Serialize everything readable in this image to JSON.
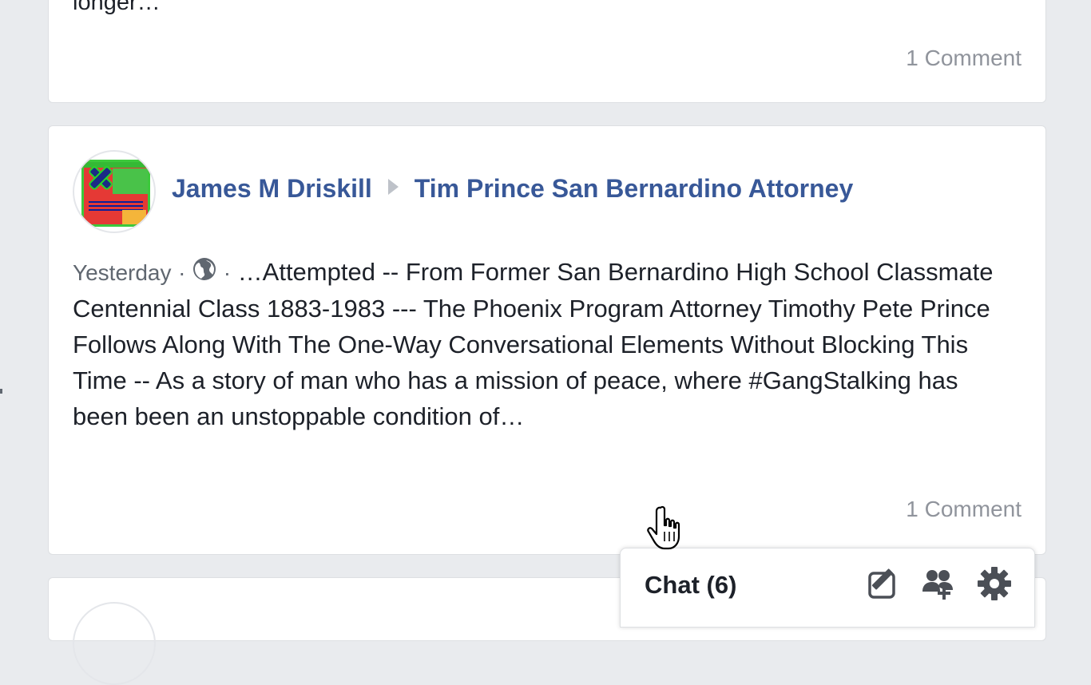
{
  "posts": [
    {
      "text_end": "longer…",
      "comments": "1 Comment"
    },
    {
      "author": "James M Driskill",
      "target": "Tim Prince San Bernardino Attorney",
      "timestamp": "Yesterday",
      "separator": "·",
      "privacy_icon": "globe-icon",
      "text": "…Attempted -- From Former San Bernardino High School Classmate Centennial Class 1883-1983 --- The Phoenix Program Attorney Timothy Pete Prince Follows Along With The One-Way Conversational Elements Without Blocking This Time -- As a story of man who has a mission of peace, where #GangStalking has been been an unstoppable condition of…",
      "comments": "1 Comment"
    }
  ],
  "chat": {
    "title": "Chat (6)",
    "icons": [
      "compose-icon",
      "create-group-icon",
      "gear-icon"
    ]
  },
  "colors": {
    "link": "#385898",
    "background": "#e9ebee",
    "muted": "#90949c"
  }
}
